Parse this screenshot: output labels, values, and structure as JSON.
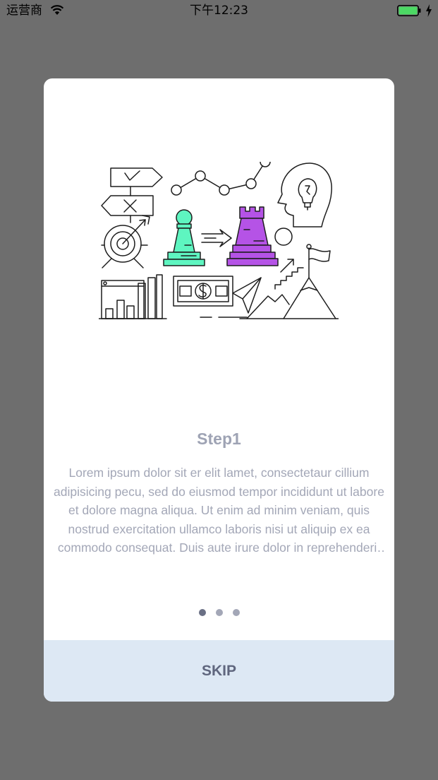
{
  "status_bar": {
    "carrier": "运营商",
    "time": "下午12:23",
    "battery_color": "#4cd964"
  },
  "onboarding": {
    "title": "Step1",
    "body": "Lorem ipsum dolor sit er elit lamet, consectetaur cillium adipisicing pecu, sed do eiusmod tempor incididunt ut labore et dolore magna aliqua. Ut enim ad minim veniam, quis nostrud exercitation ullamco laboris nisi ut aliquip ex ea commodo consequat. Duis aute irure dolor in reprehenderit in voluptate velit esse cillum dolore eu fugiat nulla pariatur.",
    "pages": [
      {
        "active": true
      },
      {
        "active": false
      },
      {
        "active": false
      }
    ],
    "skip_label": "SKIP"
  },
  "colors": {
    "backdrop": "#6e6e6e",
    "pawn": "#5ef5c0",
    "rook": "#b553e6",
    "skip_background": "#dde8f4",
    "text": "#a3a7b7"
  },
  "illustration_icons": [
    "signpost-icon",
    "target-icon",
    "line-graph-icon",
    "idea-head-icon",
    "pawn-icon",
    "rook-icon",
    "bar-chart-icon",
    "money-icon",
    "paper-plane-icon",
    "mountain-flag-icon"
  ]
}
